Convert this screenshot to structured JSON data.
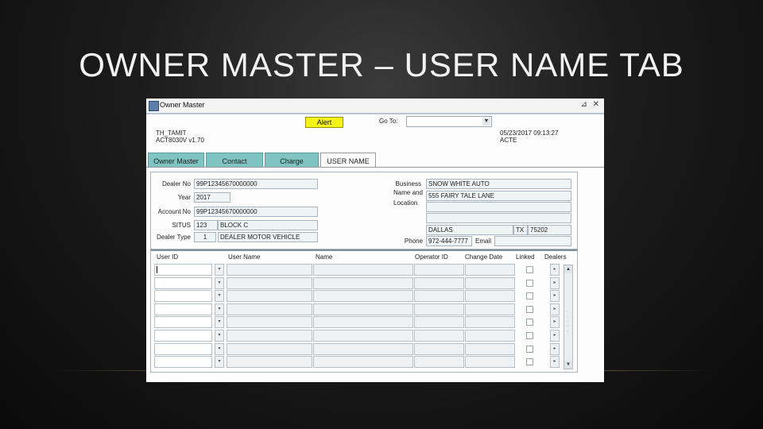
{
  "slide": {
    "title": "OWNER MASTER – USER NAME TAB"
  },
  "window": {
    "title": "Owner Master",
    "controls": "⊿ ✕",
    "icon": "app-window-icon"
  },
  "toolbar": {
    "alert_label": "Alert",
    "goto_label": "Go To:",
    "goto_value": ""
  },
  "header_info": {
    "user_code": "TH_TAMIT",
    "form_version": "ACT8030V  v1.70",
    "date_time": "05/23/2017 09:13:27",
    "status": "ACTE"
  },
  "tabs": [
    {
      "label": "Owner Master",
      "active": false
    },
    {
      "label": "Contact",
      "active": false
    },
    {
      "label": "Charge",
      "active": false
    },
    {
      "label": "USER NAME",
      "active": true
    }
  ],
  "account": {
    "dealer_no_label": "Dealer No",
    "dealer_no": "99P12345670000000",
    "year_label": "Year",
    "year": "2017",
    "account_no_label": "Account No",
    "account_no": "99P12345670000000",
    "situs_label": "SITUS",
    "situs_number": "123",
    "situs_street": "BLOCK C",
    "dealer_type_label": "Dealer Type",
    "dealer_type_code": "1",
    "dealer_type_desc": "DEALER MOTOR VEHICLE"
  },
  "business": {
    "business_label": "Business",
    "business_name": "SNOW WHITE AUTO",
    "name_and_label": "Name and",
    "location_label": "Location",
    "address": "555 FAIRY TALE LANE",
    "address_line2": "",
    "address_line3": "",
    "city": "DALLAS",
    "state": "TX",
    "zip": "75202",
    "phone_label": "Phone",
    "phone": "972-444-7777",
    "email_label": "Email",
    "email": ""
  },
  "grid": {
    "columns": [
      "User ID",
      "User Name",
      "Name",
      "Operator ID",
      "Change Date",
      "Linked",
      "Dealers"
    ],
    "row_count": 8,
    "rows": [
      {
        "user_id": "",
        "user_name": "",
        "name": "",
        "operator_id": "",
        "change_date": "",
        "linked": false
      },
      {
        "user_id": "",
        "user_name": "",
        "name": "",
        "operator_id": "",
        "change_date": "",
        "linked": false
      },
      {
        "user_id": "",
        "user_name": "",
        "name": "",
        "operator_id": "",
        "change_date": "",
        "linked": false
      },
      {
        "user_id": "",
        "user_name": "",
        "name": "",
        "operator_id": "",
        "change_date": "",
        "linked": false
      },
      {
        "user_id": "",
        "user_name": "",
        "name": "",
        "operator_id": "",
        "change_date": "",
        "linked": false
      },
      {
        "user_id": "",
        "user_name": "",
        "name": "",
        "operator_id": "",
        "change_date": "",
        "linked": false
      },
      {
        "user_id": "",
        "user_name": "",
        "name": "",
        "operator_id": "",
        "change_date": "",
        "linked": false
      },
      {
        "user_id": "",
        "user_name": "",
        "name": "",
        "operator_id": "",
        "change_date": "",
        "linked": false
      }
    ]
  },
  "colors": {
    "alert_yellow": "#f6f31a",
    "tab_teal": "#80c3c3",
    "field_bg": "#eef3f6"
  }
}
